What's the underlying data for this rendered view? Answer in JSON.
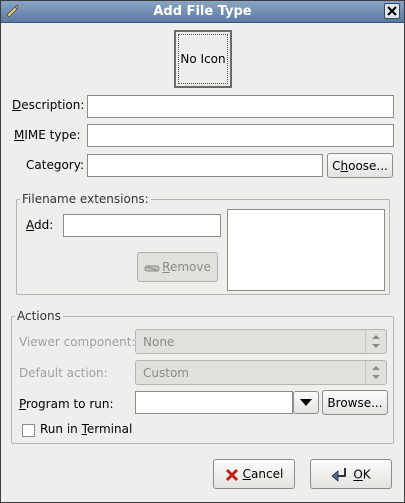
{
  "window": {
    "title": "Add File Type"
  },
  "icon_button": {
    "label": "No Icon"
  },
  "fields": {
    "description": {
      "label_pre": "",
      "label_u": "D",
      "label_post": "escription:",
      "value": ""
    },
    "mime": {
      "label_pre": "",
      "label_u": "M",
      "label_post": "IME type:",
      "value": ""
    },
    "category": {
      "label_pre": "Category:",
      "value": ""
    },
    "choose": {
      "pre": "C",
      "u": "h",
      "post": "oose..."
    }
  },
  "extensions": {
    "title": "Filename extensions:",
    "add_label_u": "A",
    "add_label_post": "dd:",
    "add_value": "",
    "remove_pre": "",
    "remove_u": "R",
    "remove_post": "emove"
  },
  "actions": {
    "title": "Actions",
    "viewer_label": "Viewer component:",
    "viewer_value": "None",
    "default_label": "Default action:",
    "default_value": "Custom",
    "program_label_u": "P",
    "program_label_post": "rogram to run:",
    "program_value": "",
    "browse": "Browse...",
    "terminal_pre": "Run in ",
    "terminal_u": "T",
    "terminal_post": "erminal"
  },
  "buttons": {
    "cancel_u": "C",
    "cancel_post": "ancel",
    "ok_u": "O",
    "ok_post": "K"
  }
}
